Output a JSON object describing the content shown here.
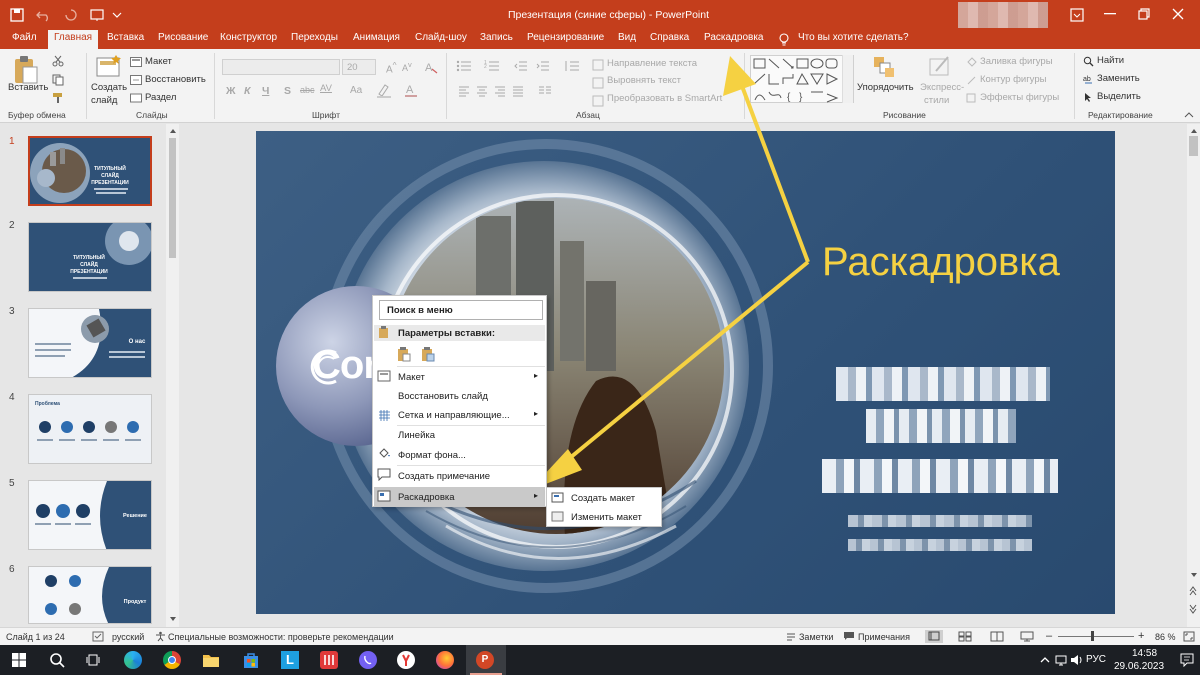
{
  "window": {
    "title": "Презентация (синие сферы)  -  PowerPoint",
    "controls": {
      "minimize": "minimize-icon",
      "maximize": "maximize-icon",
      "close": "close-icon"
    }
  },
  "tabs": [
    "Файл",
    "Главная",
    "Вставка",
    "Рисование",
    "Конструктор",
    "Переходы",
    "Анимация",
    "Слайд-шоу",
    "Запись",
    "Рецензирование",
    "Вид",
    "Справка",
    "Раскадровка"
  ],
  "tell_me": "Что вы хотите сделать?",
  "ribbon": {
    "clipboard": {
      "paste": "Вставить",
      "group": "Буфер обмена"
    },
    "slides": {
      "new_slide_line1": "Создать",
      "new_slide_line2": "слайд",
      "layout": "Макет",
      "reset": "Восстановить",
      "section": "Раздел",
      "group": "Слайды"
    },
    "font": {
      "size": "20",
      "bold": "Ж",
      "italic": "К",
      "underline": "Ч",
      "strike": "S",
      "shadow": "abc",
      "spacing": "AV",
      "case": "Aa",
      "group": "Шрифт"
    },
    "paragraph": {
      "text_direction": "Направление текста",
      "align_text": "Выровнять текст",
      "smartart": "Преобразовать в SmartArt",
      "group": "Абзац"
    },
    "drawing": {
      "arrange": "Упорядочить",
      "quick_styles_line1": "Экспресс-",
      "quick_styles_line2": "стили",
      "fill": "Заливка фигуры",
      "outline": "Контур фигуры",
      "effects": "Эффекты фигуры",
      "group": "Рисование"
    },
    "editing": {
      "find": "Найти",
      "replace": "Заменить",
      "select": "Выделить",
      "group": "Редактирование"
    }
  },
  "thumbnails": [
    {
      "num": "1",
      "title": "ТИТУЛЬНЫЙ СЛАЙД ПРЕЗЕНТАЦИИ"
    },
    {
      "num": "2",
      "title": "ТИТУЛЬНЫЙ СЛАЙД ПРЕЗЕНТАЦИИ"
    },
    {
      "num": "3",
      "title": "О нас"
    },
    {
      "num": "4",
      "title": "Проблема"
    },
    {
      "num": "5",
      "title": "Решение"
    },
    {
      "num": "6",
      "title": "Продукт"
    }
  ],
  "slide": {
    "logo_text": "Cont"
  },
  "annotation": {
    "label": "Раскадровка",
    "color": "#f5d142"
  },
  "context_menu": {
    "search": "Поиск в меню",
    "paste_options": "Параметры вставки:",
    "items": [
      "Макет",
      "Восстановить слайд",
      "Сетка и направляющие...",
      "Линейка",
      "Формат фона...",
      "Создать примечание",
      "Раскадровка"
    ]
  },
  "submenu": {
    "items": [
      "Создать макет",
      "Изменить макет"
    ]
  },
  "status": {
    "slide_of": "Слайд 1 из 24",
    "language": "русский",
    "accessibility": "Специальные возможности: проверьте рекомендации",
    "notes": "Заметки",
    "comments": "Примечания",
    "zoom": "86 %",
    "zoom_level": 0.86
  },
  "taskbar": {
    "lang": "РУС",
    "time": "14:58",
    "date": "29.06.2023"
  },
  "colors": {
    "accent": "#c43e1c",
    "annotation": "#f5d142",
    "slide_bg": "#2f5177"
  }
}
